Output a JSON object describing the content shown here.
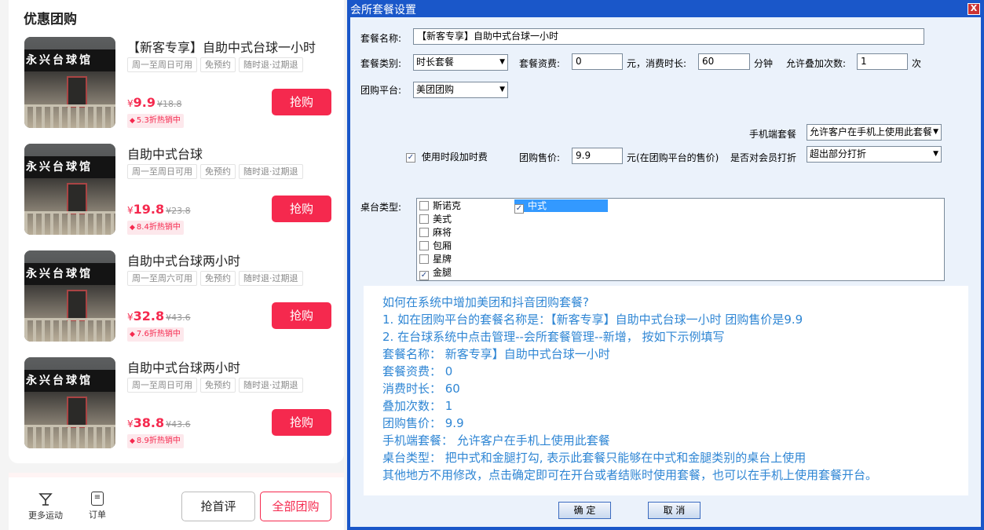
{
  "left": {
    "section_title": "优惠团购",
    "store_sign": "永兴台球馆",
    "deals": [
      {
        "title": "【新客专享】自助中式台球一小时",
        "tags": [
          "周一至周日可用",
          "免预约",
          "随时退·过期退"
        ],
        "currency": "¥",
        "price": "9.9",
        "original": "¥18.8",
        "discount": "5.3折热销中",
        "buy": "抢购"
      },
      {
        "title": "自助中式台球",
        "tags": [
          "周一至周日可用",
          "免预约",
          "随时退·过期退"
        ],
        "currency": "¥",
        "price": "19.8",
        "original": "¥23.8",
        "discount": "8.4折热销中",
        "buy": "抢购"
      },
      {
        "title": "自助中式台球两小时",
        "tags": [
          "周一至周六可用",
          "免预约",
          "随时退·过期退"
        ],
        "currency": "¥",
        "price": "32.8",
        "original": "¥43.6",
        "discount": "7.6折热销中",
        "buy": "抢购"
      },
      {
        "title": "自助中式台球两小时",
        "tags": [
          "周一至周日可用",
          "免预约",
          "随时退·过期退"
        ],
        "currency": "¥",
        "price": "38.8",
        "original": "¥43.6",
        "discount": "8.9折热销中",
        "buy": "抢购"
      }
    ],
    "bottom": {
      "more_sports": "更多运动",
      "more_sports_icon": "cocktail-glass-icon",
      "orders": "订单",
      "orders_icon": "order-list-icon",
      "first_review": "抢首评",
      "all_deals": "全部团购"
    },
    "accent": "#f5294e"
  },
  "dialog": {
    "title": "会所套餐设置",
    "close": "X",
    "name_label": "套餐名称:",
    "name_value": "【新客专享】自助中式台球一小时",
    "type_label": "套餐类别:",
    "type_value": "时长套餐",
    "fee_label": "套餐资费:",
    "fee_value": "0",
    "duration_prefix": "元，消费时长:",
    "duration_value": "60",
    "minutes_label": "分钟",
    "stack_label": "允许叠加次数:",
    "stack_value": "1",
    "times_label": "次",
    "platform_label": "团购平台:",
    "platform_value": "美团团购",
    "mobile_label": "手机端套餐",
    "mobile_value": "允许客户在手机上使用此套餐",
    "time_surcharge_label": "使用时段加时费",
    "time_surcharge_checked": true,
    "group_price_label": "团购售价:",
    "group_price_value": "9.9",
    "group_price_suffix": "元(在团购平台的售价)",
    "member_discount_label": "是否对会员打折",
    "member_discount_value": "超出部分打折",
    "table_type_label": "桌台类型:",
    "table_types": [
      {
        "name": "斯诺克",
        "checked": false
      },
      {
        "name": "美式",
        "checked": false
      },
      {
        "name": "麻将",
        "checked": false
      },
      {
        "name": "包厢",
        "checked": false
      },
      {
        "name": "星牌",
        "checked": false
      },
      {
        "name": "金腿",
        "checked": true
      }
    ],
    "table_type_selected": {
      "name": "中式",
      "checked": true
    },
    "ok": "确 定",
    "cancel": "取 消",
    "note_lines": [
      "如何在系统中增加美团和抖音团购套餐?",
      "1. 如在团购平台的套餐名称是：【新客专享】自助中式台球一小时 团购售价是9.9",
      "2. 在台球系统中点击管理--会所套餐管理--新增， 按如下示例填写",
      "套餐名称： 新客专享】自助中式台球一小时",
      "套餐资费： 0",
      "消费时长： 60",
      "叠加次数： 1",
      "团购售价： 9.9",
      "手机端套餐： 允许客户在手机上使用此套餐",
      "桌台类型： 把中式和金腿打勾, 表示此套餐只能够在中式和金腿类别的桌台上使用",
      "其他地方不用修改，点击确定即可在开台或者结账时使用套餐，也可以在手机上使用套餐开台。"
    ],
    "note_color": "#2f86d4",
    "title_bar_color": "#1a57c9"
  }
}
